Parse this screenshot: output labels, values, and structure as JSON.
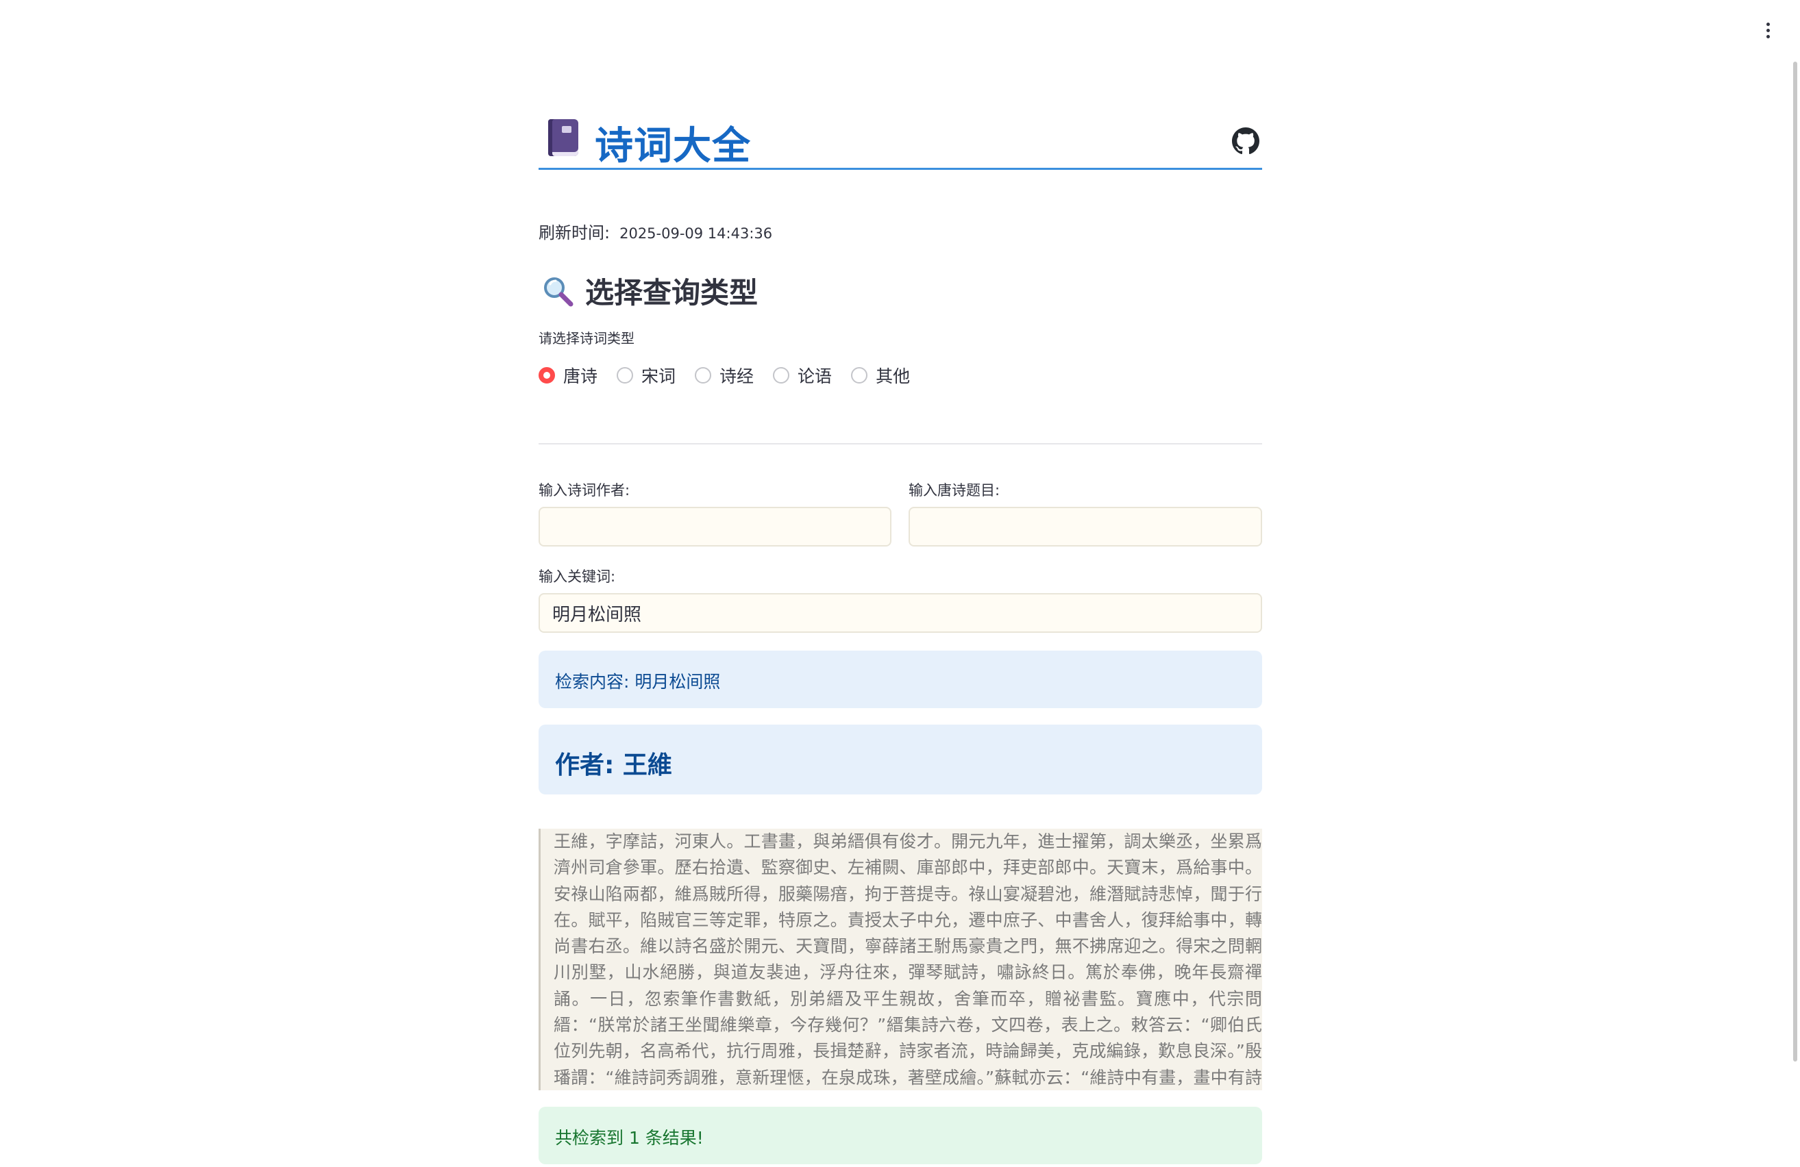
{
  "header": {
    "title": "诗词大全",
    "book_icon": "closed-book-icon",
    "github_icon": "github-icon"
  },
  "refresh": {
    "label": "刷新时间:",
    "value": "2025-09-09 14:43:36"
  },
  "query_section": {
    "title": "选择查询类型",
    "icon": "magnifying-glass-icon",
    "type_label": "请选择诗词类型",
    "options": [
      {
        "label": "唐诗",
        "selected": true
      },
      {
        "label": "宋词",
        "selected": false
      },
      {
        "label": "诗经",
        "selected": false
      },
      {
        "label": "论语",
        "selected": false
      },
      {
        "label": "其他",
        "selected": false
      }
    ]
  },
  "form": {
    "author_label": "输入诗词作者:",
    "author_value": "",
    "title_label": "输入唐诗题目:",
    "title_value": "",
    "keyword_label": "输入关键词:",
    "keyword_value": "明月松间照"
  },
  "results": {
    "search_content": "检索内容: 明月松间照",
    "author_heading": "作者: 王維",
    "bio": "王維，字摩詰，河東人。工書畫，與弟縉俱有俊才。開元九年，進士擢第，調太樂丞，坐累爲濟州司倉參軍。歷右拾遺、監察御史、左補闕、庫部郎中，拜吏部郎中。天寶末，爲給事中。安祿山陷兩都，維爲賊所得，服藥陽瘖，拘于菩提寺。祿山宴凝碧池，維潛賦詩悲悼，聞于行在。賦平，陷賊官三等定罪，特原之。責授太子中允，遷中庶子、中書舍人，復拜給事中，轉尚書右丞。維以詩名盛於開元、天寶間，寧薛諸王駙馬豪貴之門，無不拂席迎之。得宋之問輞川別墅，山水絕勝，與道友裴迪，浮舟往來，彈琴賦詩，嘯詠終日。篤於奉佛，晚年長齋禪誦。一日，忽索筆作書數紙，別弟縉及平生親故，舍筆而卒，贈祕書監。寶應中，代宗問縉：“朕常於諸王坐聞維樂章，今存幾何？”縉集詩六卷，文四卷，表上之。敕答云：“卿伯氏位列先朝，名高希代，抗行周雅，長揖楚辭，詩家者流，時論歸美，克成編錄，歎息良深。”殷璠謂：“維詩詞秀調雅，意新理愜，在泉成珠，著壁成繪。”蘇軾亦云：“維詩中有畫，畫中有詩也。”今編詩四卷。",
    "success": "共检索到 1 条结果!"
  },
  "colors": {
    "accent": "#ff4b4b",
    "title_blue": "#1668c4",
    "info_bg": "#e6f0fb",
    "success_bg": "#e3f7ea"
  }
}
